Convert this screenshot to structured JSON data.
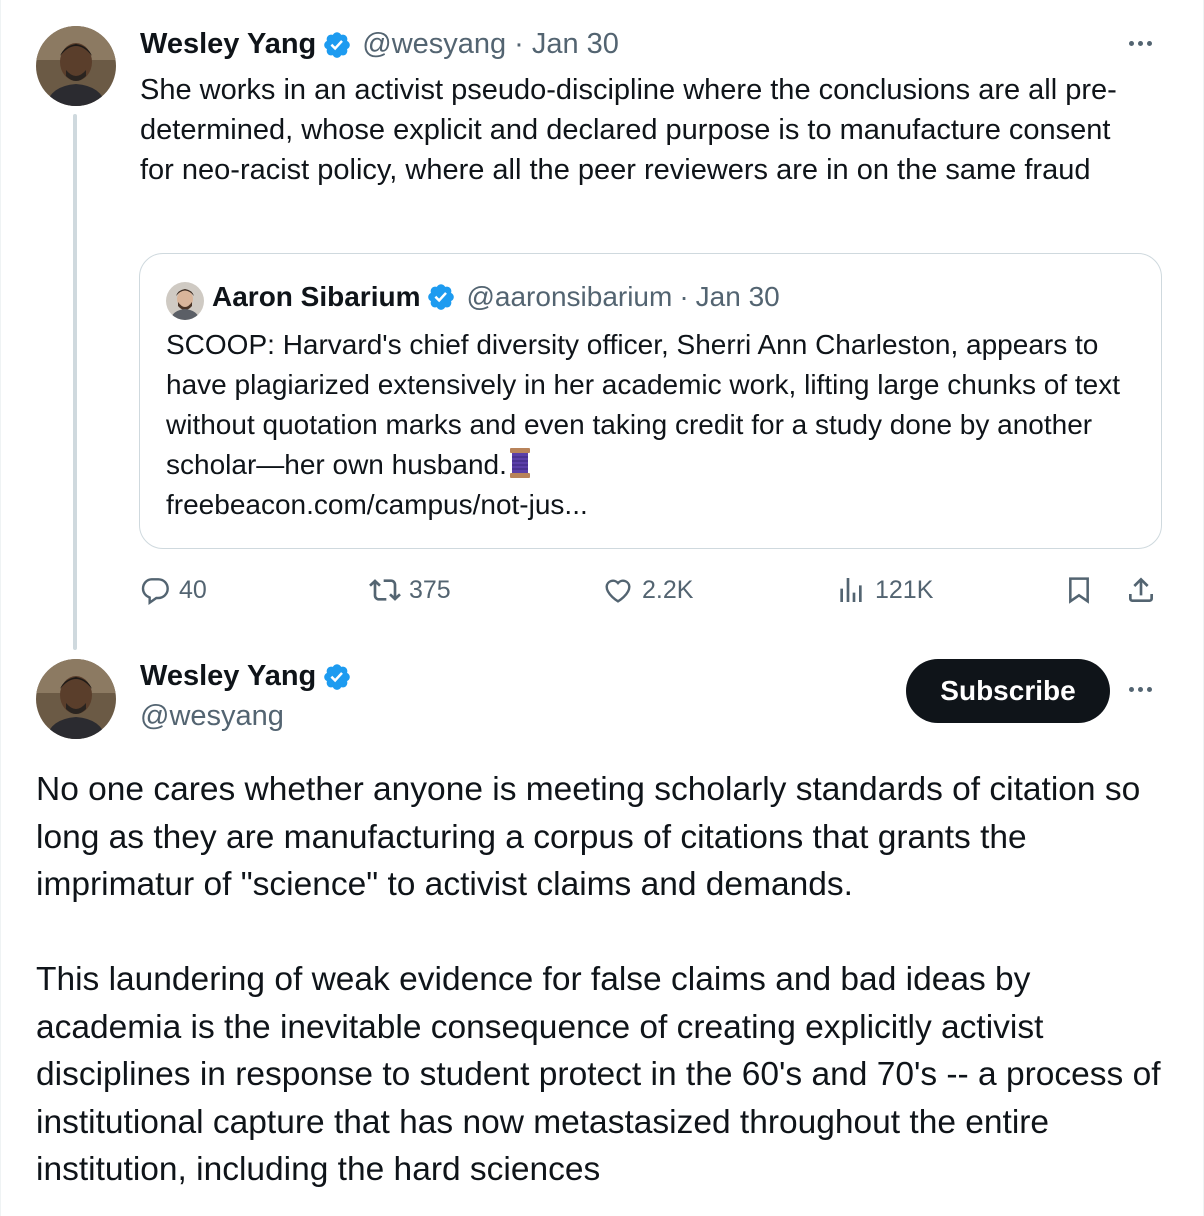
{
  "tweet": {
    "author_name": "Wesley Yang",
    "handle": "@wesyang",
    "separator": "·",
    "date": "Jan 30",
    "text": "She works in an activist pseudo-discipline where the conclusions are all pre-determined, whose explicit and declared purpose is to manufacture consent for neo-racist policy, where all the peer reviewers are in on the same fraud",
    "more_icon": "more-dots-icon",
    "verified_icon": "verified-badge-icon"
  },
  "quoted": {
    "author_name": "Aaron Sibarium",
    "handle": "@aaronsibarium",
    "separator": "·",
    "date": "Jan 30",
    "text": "SCOOP: Harvard's chief diversity officer, Sherri Ann Charleston, appears to have plagiarized extensively in her academic work, lifting large chunks of text without quotation marks and even taking credit for a study done by another scholar—her own husband.",
    "emoji_icon": "spool-of-thread-icon",
    "link": "freebeacon.com/campus/not-jus..."
  },
  "actions": {
    "replies": "40",
    "reposts": "375",
    "likes": "2.2K",
    "views": "121K",
    "reply_icon": "reply-icon",
    "repost_icon": "repost-icon",
    "like_icon": "heart-icon",
    "views_icon": "views-chart-icon",
    "bookmark_icon": "bookmark-icon",
    "share_icon": "share-icon"
  },
  "main": {
    "author_name": "Wesley Yang",
    "handle": "@wesyang",
    "subscribe_label": "Subscribe",
    "text": "No one cares whether anyone is meeting scholarly standards of citation so long as they are manufacturing a corpus of citations that grants the imprimatur of \"science\" to activist claims and demands.\n\nThis laundering of weak evidence for false claims and bad ideas by academia is the inevitable consequence of creating explicitly activist disciplines in response to student protect in the 60's and 70's -- a process of institutional capture that has now metastasized throughout the entire institution, including the hard sciences"
  },
  "colors": {
    "text": "#0f1419",
    "secondary": "#536471",
    "verified": "#1d9bf0",
    "border": "#cfd9de"
  }
}
